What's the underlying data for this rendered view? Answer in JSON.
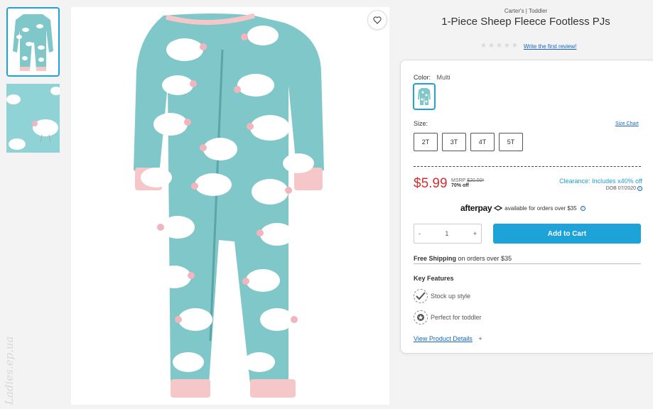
{
  "product": {
    "brand": "Carter's | Toddler",
    "title": "1-Piece Sheep Fleece Footless PJs",
    "review_link": "Write the first review!",
    "rating": 0
  },
  "watermark": "Ladies.ep.ua",
  "color": {
    "label": "Color:",
    "value": "Multi"
  },
  "size": {
    "label": "Size:",
    "chart_link": "Size Chart",
    "options": [
      "2T",
      "3T",
      "4T",
      "5T"
    ]
  },
  "price": {
    "current": "$5.99",
    "msrp_label": "MSRP",
    "msrp_value": "$20.00*",
    "percent_off": "70% off",
    "clearance": "Clearance: Includes x40% off",
    "dob": "DOB 07/2020"
  },
  "afterpay": {
    "logo": "afterpay",
    "text": "available for orders over $35"
  },
  "quantity": {
    "minus": "-",
    "value": "1",
    "plus": "+"
  },
  "cart": {
    "button": "Add to Cart"
  },
  "shipping": {
    "bold": "Free Shipping",
    "text": "on orders over $35"
  },
  "features": {
    "title": "Key Features",
    "items": [
      {
        "icon": "checkmark-icon",
        "text": "Stock up style"
      },
      {
        "icon": "star-badge-icon",
        "text": "Perfect for toddler"
      }
    ],
    "view_link": "View Product Details",
    "view_plus": "+"
  },
  "colors": {
    "fabric": "#7fc7c9",
    "fabric_dark": "#6bb5b8",
    "cuff": "#f6c7c9",
    "accent": "#1ea3d8",
    "price_red": "#d32f2f"
  }
}
